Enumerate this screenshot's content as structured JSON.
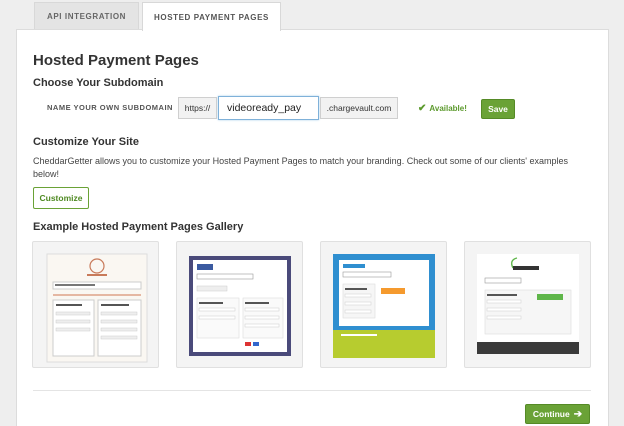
{
  "tabs": [
    {
      "label": "API INTEGRATION",
      "active": false
    },
    {
      "label": "HOSTED PAYMENT PAGES",
      "active": true
    }
  ],
  "page_title": "Hosted Payment Pages",
  "subdomain": {
    "heading": "Choose Your Subdomain",
    "label": "NAME YOUR OWN SUBDOMAIN",
    "prefix": "https://",
    "value": "videoready_pay",
    "suffix": ".chargevault.com",
    "status": "Available!",
    "save_label": "Save"
  },
  "customize": {
    "heading": "Customize Your Site",
    "description": "CheddarGetter allows you to customize your Hosted Payment Pages to match your branding. Check out some of our clients' examples below!",
    "button_label": "Customize"
  },
  "gallery": {
    "heading": "Example Hosted Payment Pages Gallery",
    "items": [
      {
        "id": "example-1",
        "accent": "#c87a5a"
      },
      {
        "id": "example-2",
        "accent": "#4a4a7a"
      },
      {
        "id": "example-3",
        "accent": "#2f8fd0"
      },
      {
        "id": "example-4",
        "accent": "#5fb64a"
      }
    ]
  },
  "continue_label": "Continue",
  "colors": {
    "green": "#6aa236",
    "available": "#5c9a2d"
  }
}
